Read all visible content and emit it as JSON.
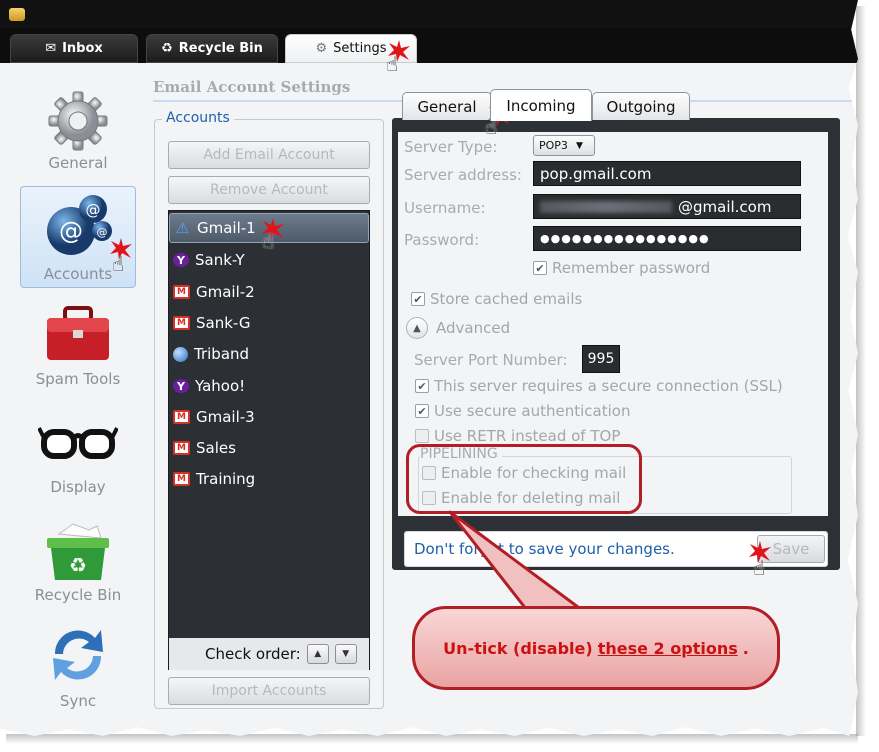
{
  "window_tabs": [
    {
      "label": "Inbox",
      "icon": "envelope-icon"
    },
    {
      "label": "Recycle Bin",
      "icon": "recycle-icon"
    },
    {
      "label": "Settings",
      "icon": "gear-icon",
      "active": true
    }
  ],
  "nav": [
    {
      "label": "General",
      "icon": "gear-icon"
    },
    {
      "label": "Accounts",
      "icon": "at-sign-icon",
      "active": true
    },
    {
      "label": "Spam Tools",
      "icon": "toolbox-icon"
    },
    {
      "label": "Display",
      "icon": "glasses-icon"
    },
    {
      "label": "Recycle Bin",
      "icon": "recycle-bin-icon"
    },
    {
      "label": "Sync",
      "icon": "sync-arrows-icon"
    }
  ],
  "section_title": "Email Account Settings",
  "accounts": {
    "legend": "Accounts",
    "add_button": "Add Email Account",
    "remove_button": "Remove Account",
    "items": [
      {
        "label": "Gmail-1",
        "icon": "warning-icon",
        "selected": true
      },
      {
        "label": "Sank-Y",
        "icon": "yahoo-icon"
      },
      {
        "label": "Gmail-2",
        "icon": "gmail-icon"
      },
      {
        "label": "Sank-G",
        "icon": "gmail-icon"
      },
      {
        "label": "Triband",
        "icon": "globe-icon"
      },
      {
        "label": "Yahoo!",
        "icon": "yahoo-icon"
      },
      {
        "label": "Gmail-3",
        "icon": "gmail-icon"
      },
      {
        "label": "Sales",
        "icon": "gmail-icon"
      },
      {
        "label": "Training",
        "icon": "gmail-icon"
      }
    ],
    "check_order_label": "Check order:",
    "import_button": "Import Accounts"
  },
  "panel_tabs": [
    {
      "label": "General"
    },
    {
      "label": "Incoming",
      "active": true
    },
    {
      "label": "Outgoing"
    }
  ],
  "incoming": {
    "server_type_label": "Server Type:",
    "server_type_value": "POP3",
    "server_address_label": "Server address:",
    "server_address_value": "pop.gmail.com",
    "username_label": "Username:",
    "username_value": "@gmail.com",
    "password_label": "Password:",
    "password_value": "●●●●●●●●●●●●●●●●",
    "remember_password": {
      "label": "Remember password",
      "checked": true
    },
    "store_cached": {
      "label": "Store cached emails",
      "checked": true
    },
    "advanced_label": "Advanced",
    "server_port_label": "Server Port Number:",
    "server_port_value": "995",
    "ssl": {
      "label": "This server requires a secure connection (SSL)",
      "checked": true
    },
    "secure_auth": {
      "label": "Use secure authentication",
      "checked": true
    },
    "retr": {
      "label": "Use RETR instead of TOP",
      "checked": false
    },
    "pipelining_legend": "PIPELINING",
    "enable_checking": {
      "label": "Enable for checking mail",
      "checked": false
    },
    "enable_deleting": {
      "label": "Enable for deleting mail",
      "checked": false
    }
  },
  "save_bar": {
    "message": "Don't forget to save your changes.",
    "save_button": "Save"
  },
  "callout": {
    "text_prefix": "Un-tick (disable)",
    "text_link": "these 2 options",
    "text_suffix": "."
  },
  "colors": {
    "accent_blue": "#1f5faa",
    "annotation_red": "#b21e25",
    "panel_dark": "#2d3034"
  }
}
